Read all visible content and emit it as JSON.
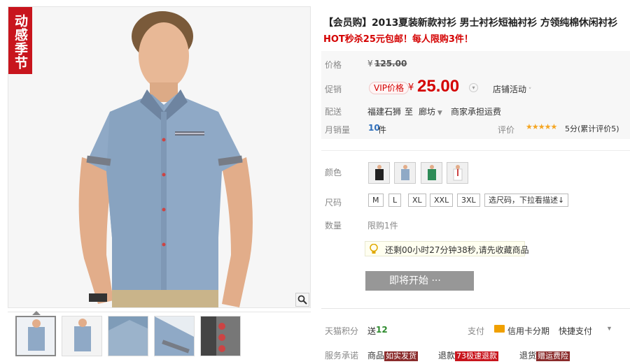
{
  "gallery": {
    "promo_tag": "动感季节",
    "zoom_icon": "magnifier-icon",
    "thumbnail_count": 5
  },
  "product": {
    "title": "【会员购】2013夏装新款衬衫 男士衬衫短袖衬衫 方领纯棉休闲衬衫",
    "subtitle": "HOT秒杀25元包邮！每人限购3件！"
  },
  "price": {
    "original_label": "价格",
    "original_currency": "¥",
    "original_value": "125.00",
    "promo_label": "促销",
    "vip_badge": "VIP价格",
    "promo_currency": "¥",
    "promo_value": "25.00",
    "store_activity": "店铺活动"
  },
  "shipping": {
    "label": "配送",
    "from": "福建石狮",
    "to_word": "至",
    "to": "廊坊",
    "fee": "商家承担运费"
  },
  "sales": {
    "label": "月销量",
    "count": "10",
    "unit": "件",
    "rating_label": "评价",
    "stars": "★★★★★",
    "rating_text": "5分(累计评价5)"
  },
  "options": {
    "color_label": "颜色",
    "colors": [
      "black",
      "light blue",
      "green",
      "white"
    ],
    "size_label": "尺码",
    "sizes": [
      "M",
      "L",
      "XL",
      "XXL",
      "3XL"
    ],
    "size_select": "选尺码，下拉看描述↓",
    "qty_label": "数量",
    "qty_text": "限购1件"
  },
  "countdown": {
    "text": "还剩00小时27分钟38秒,请先收藏商品"
  },
  "buy": {
    "label": "即将开始 ···"
  },
  "footer": {
    "points_label": "天猫积分",
    "points_prefix": "送",
    "points_value": "12",
    "pay_label": "支付",
    "pay_method": "信用卡分期",
    "quick_pay": "快捷支付",
    "service_label": "服务承诺",
    "s1": "商品",
    "s1b": "如实发货",
    "s2": "退款",
    "s2b": "73极速退款",
    "s3": "退货",
    "s3b": "赠运费险"
  },
  "colors": {
    "price_red": "#d40000",
    "button_gray": "#979797",
    "promo_tag_red": "#c8151d"
  }
}
